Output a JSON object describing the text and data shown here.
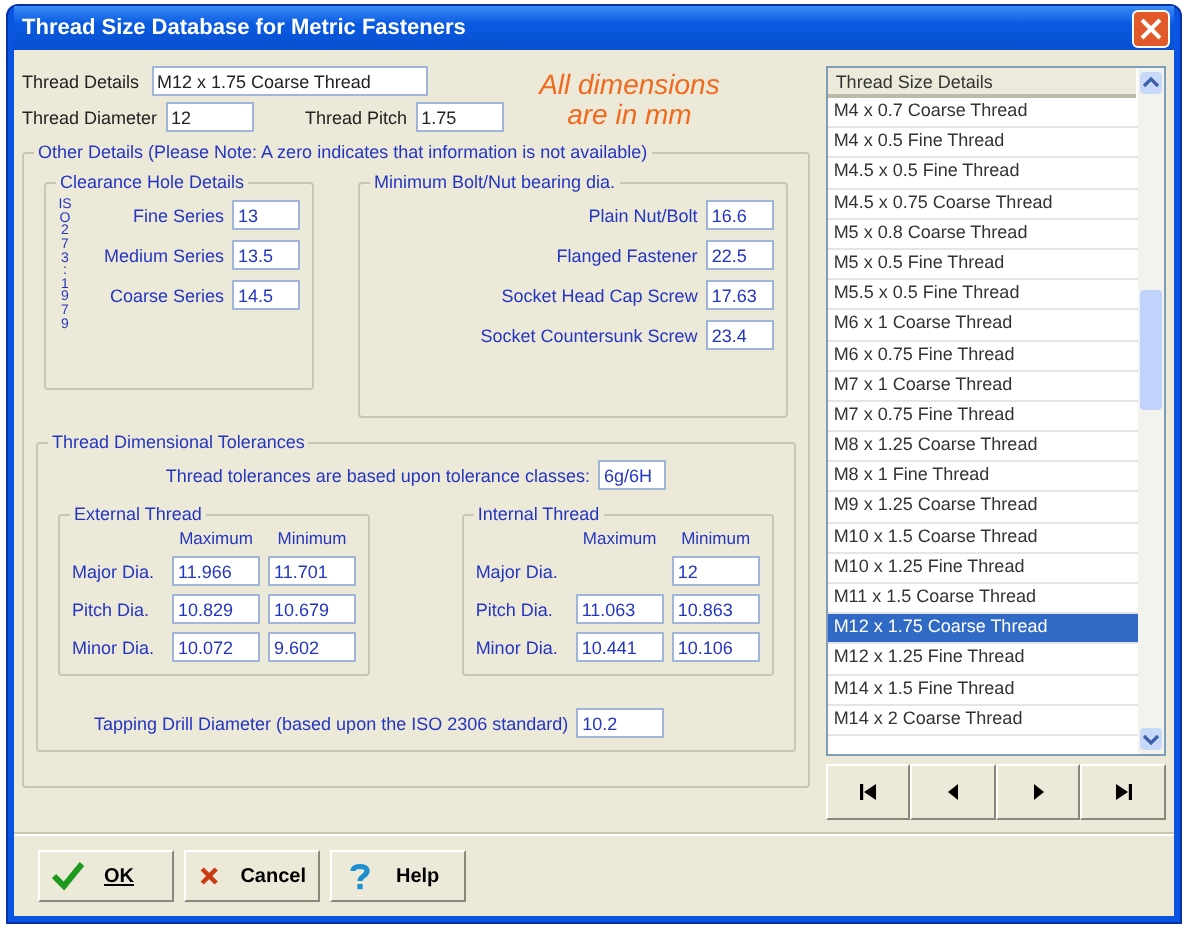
{
  "window": {
    "title": "Thread Size Database for Metric Fasteners"
  },
  "thread_details": {
    "label": "Thread Details",
    "value": "M12 x 1.75 Coarse Thread"
  },
  "thread_diameter": {
    "label": "Thread Diameter",
    "value": "12"
  },
  "thread_pitch": {
    "label": "Thread Pitch",
    "value": "1.75"
  },
  "units_note": [
    "All dimensions",
    "are in mm"
  ],
  "other_details": {
    "legend": "Other Details (Please Note: A zero indicates that information is not available)",
    "clearance": {
      "legend": "Clearance Hole Details",
      "side_label": "ISO 273 : 1979",
      "rows": [
        {
          "label": "Fine Series",
          "value": "13"
        },
        {
          "label": "Medium Series",
          "value": "13.5"
        },
        {
          "label": "Coarse Series",
          "value": "14.5"
        }
      ]
    },
    "bearing": {
      "legend": "Minimum Bolt/Nut bearing dia.",
      "rows": [
        {
          "label": "Plain Nut/Bolt",
          "value": "16.6"
        },
        {
          "label": "Flanged Fastener",
          "value": "22.5"
        },
        {
          "label": "Socket Head Cap Screw",
          "value": "17.63"
        },
        {
          "label": "Socket Countersunk Screw",
          "value": "23.4"
        }
      ]
    },
    "tolerances": {
      "legend": "Thread Dimensional Tolerances",
      "class_label": "Thread tolerances are based upon tolerance classes:",
      "class_value": "6g/6H",
      "external": {
        "legend": "External Thread",
        "columns": [
          "Maximum",
          "Minimum"
        ],
        "rows": [
          {
            "label": "Major Dia.",
            "maximum": "11.966",
            "minimum": "11.701"
          },
          {
            "label": "Pitch Dia.",
            "maximum": "10.829",
            "minimum": "10.679"
          },
          {
            "label": "Minor Dia.",
            "maximum": "10.072",
            "minimum": "9.602"
          }
        ]
      },
      "internal": {
        "legend": "Internal Thread",
        "columns": [
          "Maximum",
          "Minimum"
        ],
        "rows": [
          {
            "label": "Major Dia.",
            "minimum": "12"
          },
          {
            "label": "Pitch Dia.",
            "maximum": "11.063",
            "minimum": "10.863"
          },
          {
            "label": "Minor Dia.",
            "maximum": "10.441",
            "minimum": "10.106"
          }
        ]
      },
      "tapping": {
        "label": "Tapping Drill Diameter (based upon the ISO 2306 standard)",
        "value": "10.2"
      }
    }
  },
  "list": {
    "header": "Thread Size Details",
    "items": [
      {
        "label": "M4 x 0.7 Coarse Thread",
        "selected": false
      },
      {
        "label": "M4 x 0.5 Fine Thread",
        "selected": false
      },
      {
        "label": "M4.5 x 0.5 Fine Thread",
        "selected": false
      },
      {
        "label": "M4.5 x 0.75 Coarse Thread",
        "selected": false
      },
      {
        "label": "M5 x 0.8 Coarse Thread",
        "selected": false
      },
      {
        "label": "M5 x 0.5 Fine Thread",
        "selected": false
      },
      {
        "label": "M5.5 x 0.5 Fine Thread",
        "selected": false
      },
      {
        "label": "M6 x 1 Coarse Thread",
        "selected": false
      },
      {
        "label": "M6 x 0.75 Fine Thread",
        "selected": false
      },
      {
        "label": "M7 x 1 Coarse Thread",
        "selected": false
      },
      {
        "label": "M7 x 0.75 Fine Thread",
        "selected": false
      },
      {
        "label": "M8 x 1.25 Coarse Thread",
        "selected": false
      },
      {
        "label": "M8 x 1 Fine Thread",
        "selected": false
      },
      {
        "label": "M9 x 1.25 Coarse Thread",
        "selected": false
      },
      {
        "label": "M10 x 1.5 Coarse Thread",
        "selected": false
      },
      {
        "label": "M10 x 1.25 Fine Thread",
        "selected": false
      },
      {
        "label": "M11 x 1.5 Coarse Thread",
        "selected": false
      },
      {
        "label": "M12 x 1.75 Coarse Thread",
        "selected": true
      },
      {
        "label": "M12 x 1.25 Fine Thread",
        "selected": false
      },
      {
        "label": "M14 x 1.5 Fine Thread",
        "selected": false
      },
      {
        "label": "M14 x 2 Coarse Thread",
        "selected": false
      }
    ]
  },
  "navigator": [
    {
      "kind": "first"
    },
    {
      "kind": "prior"
    },
    {
      "kind": "next"
    },
    {
      "kind": "last"
    }
  ],
  "buttons": [
    {
      "kind": "ok",
      "label": "OK"
    },
    {
      "kind": "cancel",
      "label": "Cancel"
    },
    {
      "kind": "help",
      "label": "Help"
    }
  ]
}
